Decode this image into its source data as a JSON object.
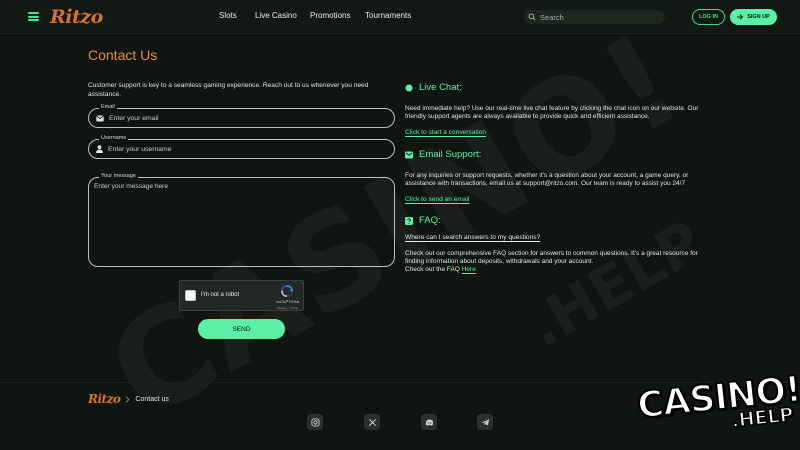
{
  "header": {
    "logo": "Ritzo",
    "nav": [
      {
        "label": "Slots"
      },
      {
        "label": "Live Casino"
      },
      {
        "label": "Promotions"
      },
      {
        "label": "Tournaments"
      }
    ],
    "search_placeholder": "Search",
    "login_label": "LOG IN",
    "signup_label": "SIGN UP"
  },
  "contact": {
    "title": "Contact Us",
    "intro": "Customer support is key to a seamless gaming experience. Reach out to us whenever you need assistance.",
    "email_label": "Email",
    "email_placeholder": "Enter your email",
    "username_label": "Username",
    "username_placeholder": "Enter your username",
    "message_label": "Your message",
    "message_placeholder": "Enter your message here",
    "captcha_label": "I'm not a robot",
    "captcha_brand": "reCAPTCHA",
    "captcha_sub": "Privacy - Terms",
    "send_label": "SEND"
  },
  "live_chat": {
    "heading": "Live Chat:",
    "text": "Need immediate help? Use our real-time live chat feature by clicking the chat icon on our website. Our friendly support agents are always available to provide quick and efficient assistance.",
    "link": "Click to start a conversation"
  },
  "email_support": {
    "heading": "Email Support:",
    "text": "For any inquiries or support requests, whether it's a question about your account, a game query, or assistance with transactions, email us at support@ritzo.com. Our team is ready to assist you 24/7",
    "link": "Click to send an email"
  },
  "faq": {
    "heading": "FAQ:",
    "question": "Where can I search answers to my questions?",
    "text": "Check out our comprehensive FAQ section for answers to common questions. It's a great resource for finding information about deposits, withdrawals and your account.",
    "checkout_prefix": "Check out the FAQ",
    "here_link": "Here"
  },
  "footer": {
    "logo": "Ritzo",
    "breadcrumb_current": "Contact us",
    "social": [
      {
        "icon": "instagram-icon"
      },
      {
        "icon": "x-icon"
      },
      {
        "icon": "discord-icon"
      },
      {
        "icon": "telegram-icon"
      }
    ]
  },
  "watermark": {
    "casino": "CASINO!",
    "help": ".HELP"
  },
  "colors": {
    "accent": "#5cf0a6",
    "title_orange": "#e98a3a",
    "background": "#101511"
  }
}
